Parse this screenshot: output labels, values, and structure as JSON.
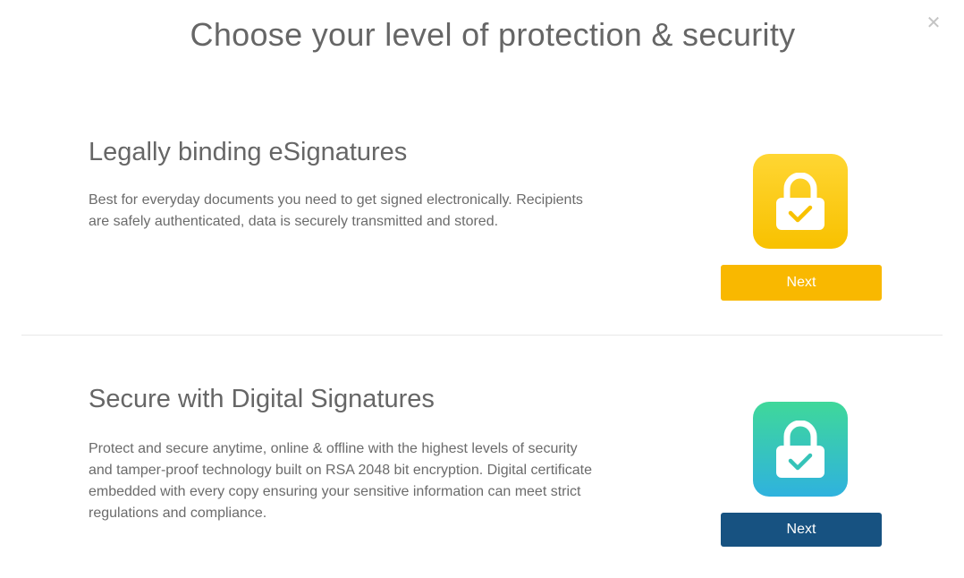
{
  "modal": {
    "title": "Choose your level of protection & security",
    "close_icon": "close-icon"
  },
  "options": [
    {
      "heading": "Legally binding eSignatures",
      "description": "Best for everyday documents you need to get signed electronically. Recipients are safely authenticated, data is securely transmitted and stored.",
      "icon": "padlock-check-icon",
      "icon_colors": [
        "#ffd633",
        "#f8c100"
      ],
      "button_label": "Next",
      "button_color": "#f9b800"
    },
    {
      "heading": "Secure with Digital Signatures",
      "description": "Protect and secure anytime, online & offline with the highest levels of security and tamper-proof technology built on RSA 2048 bit encryption. Digital certificate embedded with every copy ensuring your sensitive information can meet strict regulations and compliance.",
      "icon": "padlock-check-icon",
      "icon_colors": [
        "#3fd89a",
        "#2fb2de"
      ],
      "button_label": "Next",
      "button_color": "#175281"
    }
  ]
}
